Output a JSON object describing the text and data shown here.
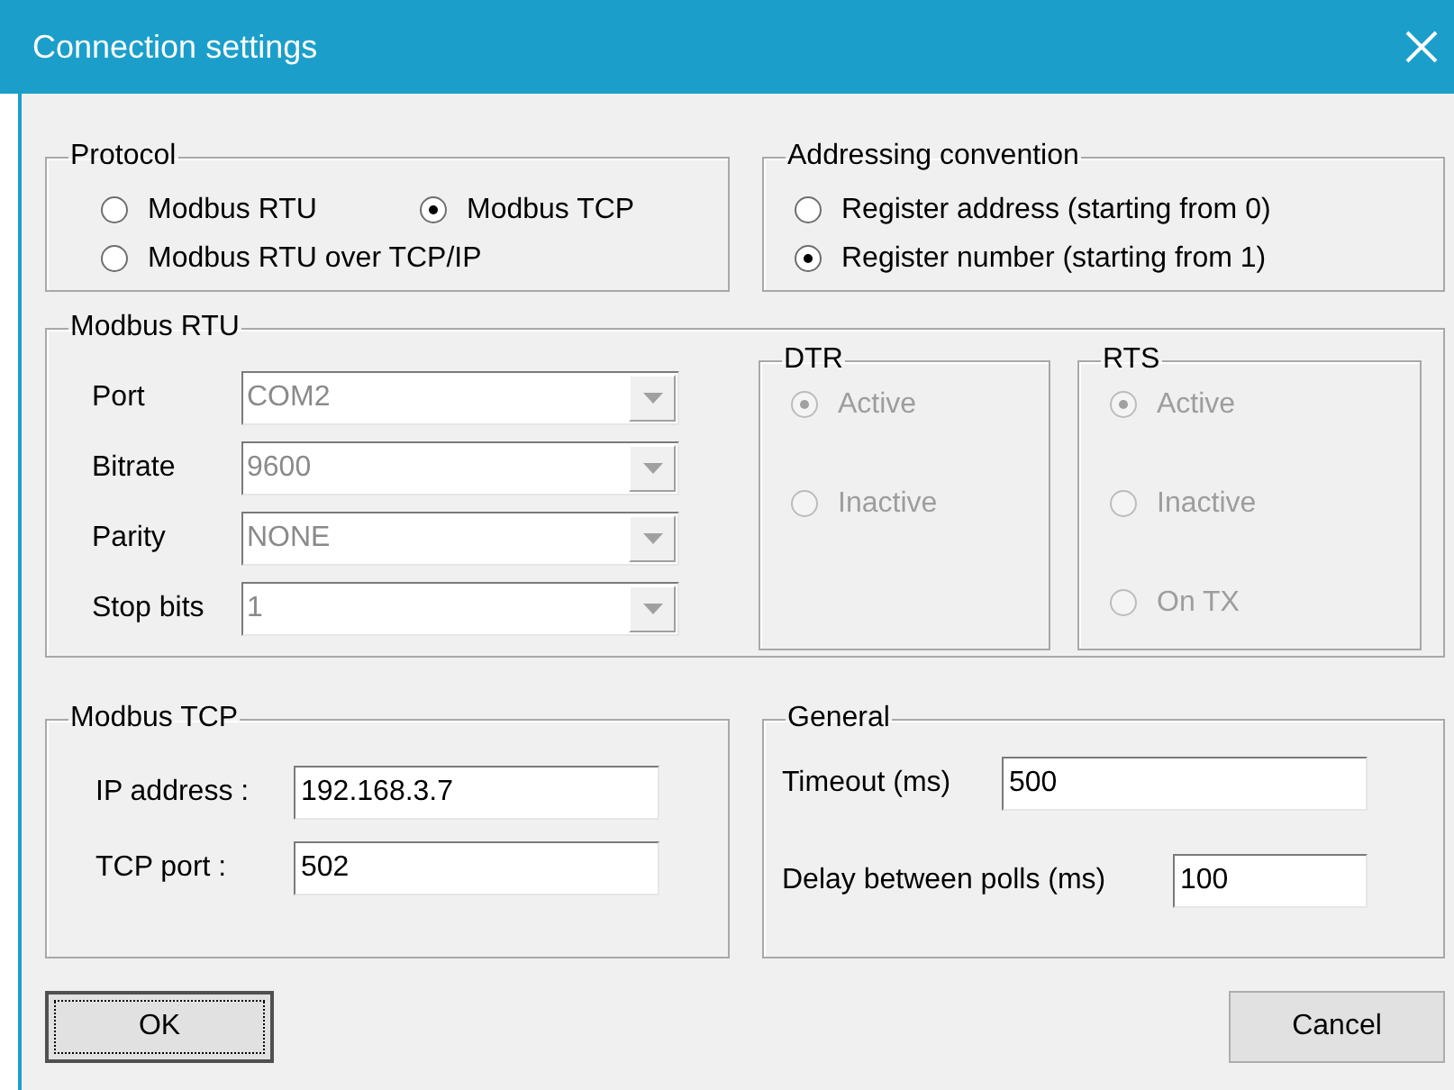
{
  "window": {
    "title": "Connection settings"
  },
  "protocol": {
    "legend": "Protocol",
    "options": [
      {
        "label": "Modbus RTU",
        "selected": false
      },
      {
        "label": "Modbus TCP",
        "selected": true
      },
      {
        "label": "Modbus RTU over TCP/IP",
        "selected": false
      }
    ]
  },
  "addressing": {
    "legend": "Addressing convention",
    "options": [
      {
        "label": "Register address (starting from 0)",
        "selected": false
      },
      {
        "label": "Register number (starting from 1)",
        "selected": true
      }
    ]
  },
  "modbus_rtu": {
    "legend": "Modbus RTU",
    "fields": [
      {
        "label": "Port",
        "value": "COM2",
        "disabled": true
      },
      {
        "label": "Bitrate",
        "value": "9600",
        "disabled": true
      },
      {
        "label": "Parity",
        "value": "NONE",
        "disabled": true
      },
      {
        "label": "Stop bits",
        "value": "1",
        "disabled": true
      }
    ],
    "dtr": {
      "legend": "DTR",
      "disabled": true,
      "options": [
        {
          "label": "Active",
          "selected": true
        },
        {
          "label": "Inactive",
          "selected": false
        }
      ]
    },
    "rts": {
      "legend": "RTS",
      "disabled": true,
      "options": [
        {
          "label": "Active",
          "selected": true
        },
        {
          "label": "Inactive",
          "selected": false
        },
        {
          "label": "On TX",
          "selected": false
        }
      ]
    }
  },
  "modbus_tcp": {
    "legend": "Modbus TCP",
    "fields": [
      {
        "label": "IP address :",
        "value": "192.168.3.7"
      },
      {
        "label": "TCP port :",
        "value": "502"
      }
    ]
  },
  "general": {
    "legend": "General",
    "fields": [
      {
        "label": "Timeout (ms)",
        "value": "500"
      },
      {
        "label": "Delay between polls (ms)",
        "value": "100"
      }
    ]
  },
  "buttons": [
    {
      "label": "OK",
      "focused": true
    },
    {
      "label": "Cancel",
      "focused": false
    }
  ]
}
